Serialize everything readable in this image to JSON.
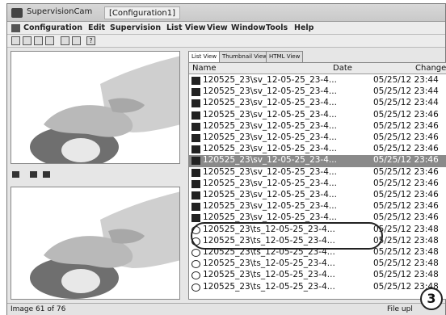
{
  "titlebar": {
    "app_title": "SupervisionCam",
    "doc_title": "[Configuration1]"
  },
  "menubar": {
    "items": [
      "Configuration",
      "Edit",
      "Supervision",
      "List View",
      "View",
      "Window",
      "Tools",
      "Help"
    ]
  },
  "tabs": [
    "List View",
    "Thumbnail View",
    "HTML View"
  ],
  "list": {
    "columns": [
      "Name",
      "Date",
      "Changed"
    ],
    "rows": [
      {
        "name": "120525_23\\sv_12-05-25_23-4...",
        "date": "05/25/12 23:44"
      },
      {
        "name": "120525_23\\sv_12-05-25_23-4...",
        "date": "05/25/12 23:44"
      },
      {
        "name": "120525_23\\sv_12-05-25_23-4...",
        "date": "05/25/12 23:44"
      },
      {
        "name": "120525_23\\sv_12-05-25_23-4...",
        "date": "05/25/12 23:46"
      },
      {
        "name": "120525_23\\sv_12-05-25_23-4...",
        "date": "05/25/12 23:46"
      },
      {
        "name": "120525_23\\sv_12-05-25_23-4...",
        "date": "05/25/12 23:46"
      },
      {
        "name": "120525_23\\sv_12-05-25_23-4...",
        "date": "05/25/12 23:46"
      },
      {
        "name": "120525_23\\sv_12-05-25_23-4...",
        "date": "05/25/12 23:46",
        "selected": true
      },
      {
        "name": "120525_23\\sv_12-05-25_23-4...",
        "date": "05/25/12 23:46"
      },
      {
        "name": "120525_23\\sv_12-05-25_23-4...",
        "date": "05/25/12 23:46"
      },
      {
        "name": "120525_23\\sv_12-05-25_23-4...",
        "date": "05/25/12 23:46"
      },
      {
        "name": "120525_23\\sv_12-05-25_23-4...",
        "date": "05/25/12 23:46"
      },
      {
        "name": "120525_23\\sv_12-05-25_23-4...",
        "date": "05/25/12 23:46"
      },
      {
        "name": "120525_23\\ts_12-05-25_23-4...",
        "date": "05/25/12 23:48",
        "icon": "clock"
      },
      {
        "name": "120525_23\\ts_12-05-25_23-4...",
        "date": "05/25/12 23:48",
        "icon": "clock"
      },
      {
        "name": "120525_23\\ts_12-05-25_23-4...",
        "date": "05/25/12 23:48",
        "icon": "clock"
      },
      {
        "name": "120525_23\\ts_12-05-25_23-4...",
        "date": "05/25/12 23:48",
        "icon": "clock"
      },
      {
        "name": "120525_23\\ts_12-05-25_23-4...",
        "date": "05/25/12 23:48",
        "icon": "clock"
      },
      {
        "name": "120525_23\\ts_12-05-25_23-4...",
        "date": "05/25/12 23:48",
        "icon": "clock"
      }
    ]
  },
  "status": {
    "left": "Image 61 of 76",
    "right": "File upl"
  },
  "badge": "3",
  "icons": {
    "file_row": "camera-icon",
    "timestamp_row": "clock-icon",
    "playback": [
      "skip-back-icon",
      "prev-icon",
      "play-icon",
      "next-icon",
      "stop-icon",
      "forward-icon"
    ]
  }
}
